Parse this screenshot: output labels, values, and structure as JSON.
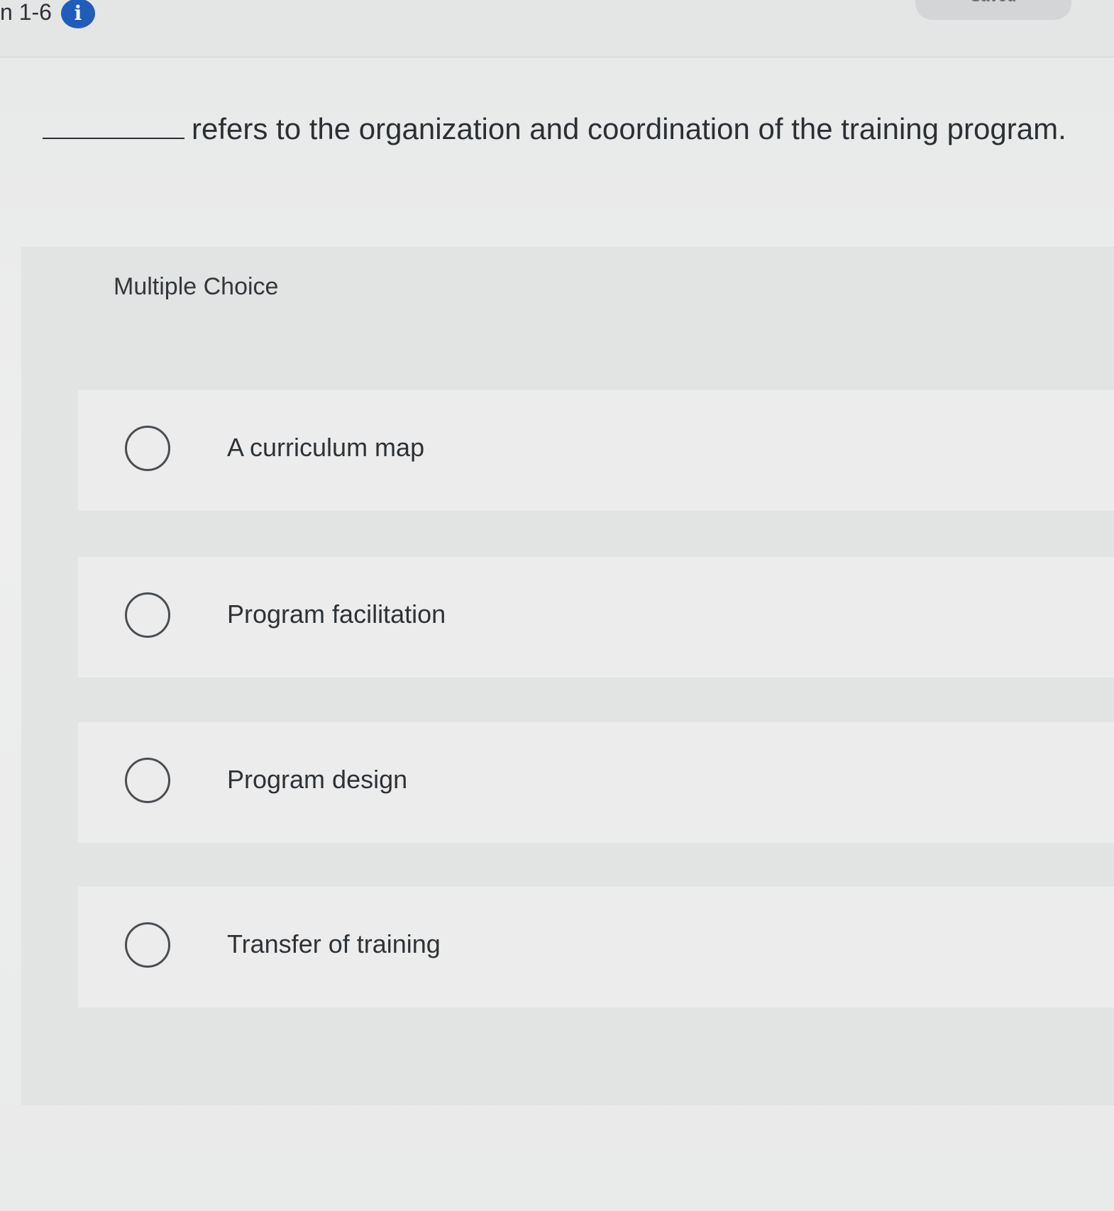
{
  "header": {
    "question_id": "n 1-6",
    "info_icon": "info-icon",
    "saved_label": "Saved"
  },
  "question": {
    "text": "refers to the organization and coordination of the training program."
  },
  "multiple_choice": {
    "heading": "Multiple Choice",
    "options": [
      {
        "label": "A curriculum map",
        "icon": "radio-unselected-icon"
      },
      {
        "label": "Program facilitation",
        "icon": "radio-unselected-icon"
      },
      {
        "label": "Program design",
        "icon": "radio-unselected-icon"
      },
      {
        "label": "Transfer of training",
        "icon": "radio-unselected-icon"
      }
    ]
  },
  "colors": {
    "info_icon": "#1f5db8",
    "text": "#2e3236",
    "panel": "#e2e3e3",
    "option": "#ececec"
  }
}
